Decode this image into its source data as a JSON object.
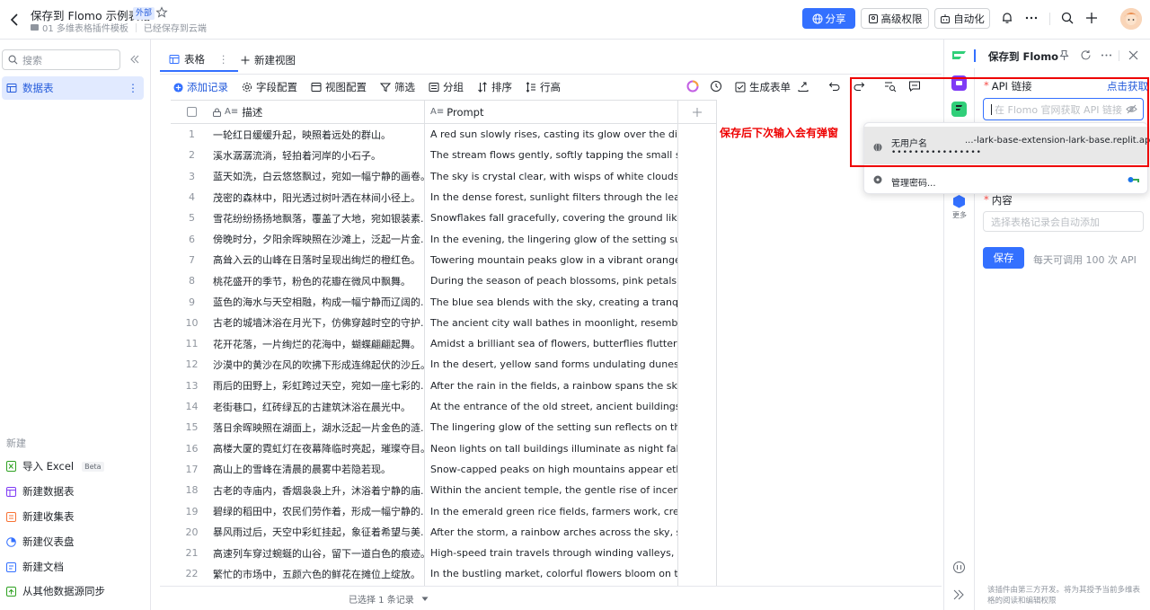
{
  "header": {
    "title": "保存到 Flomo 示例表格",
    "badge": "外部",
    "breadcrumb": "01 多维表格插件模板",
    "save_status": "已经保存到云端",
    "share_label": "分享",
    "permission_label": "高级权限",
    "automation_label": "自动化"
  },
  "sidebar": {
    "search_placeholder": "搜索",
    "active_item": "数据表",
    "new_section_label": "新建",
    "new_items": [
      {
        "label": "导入 Excel",
        "icon": "excel-icon",
        "badge": "Beta"
      },
      {
        "label": "新建数据表",
        "icon": "table-icon"
      },
      {
        "label": "新建收集表",
        "icon": "form-icon"
      },
      {
        "label": "新建仪表盘",
        "icon": "dashboard-icon"
      },
      {
        "label": "新建文档",
        "icon": "doc-icon"
      },
      {
        "label": "从其他数据源同步",
        "icon": "sync-icon"
      }
    ]
  },
  "views": {
    "active_tab": "表格",
    "new_view_label": "新建视图"
  },
  "toolbar": {
    "add_record": "添加记录",
    "field_config": "字段配置",
    "view_config": "视图配置",
    "filter": "筛选",
    "group": "分组",
    "sort": "排序",
    "row_height": "行高",
    "generate_form": "生成表单"
  },
  "table": {
    "columns": [
      "描述",
      "Prompt"
    ],
    "rows": [
      {
        "n": "1",
        "desc": "一轮红日缓缓升起，映照着远处的群山。",
        "prompt": "A red sun slowly rises, casting its glow over the distant ..."
      },
      {
        "n": "2",
        "desc": "溪水潺潺流淌，轻拍着河岸的小石子。",
        "prompt": "The stream flows gently, softly tapping the small stones..."
      },
      {
        "n": "3",
        "desc": "蓝天如洗，白云悠悠飘过，宛如一幅宁静的画卷。",
        "prompt": "The sky is crystal clear, with wisps of white clouds drifti..."
      },
      {
        "n": "4",
        "desc": "茂密的森林中，阳光透过树叶洒在林间小径上。",
        "prompt": "In the dense forest, sunlight filters through the leaves, ..."
      },
      {
        "n": "5",
        "desc": "雪花纷纷扬扬地飘落，覆盖了大地，宛如银装素...",
        "prompt": "Snowflakes fall gracefully, covering the ground like a sil..."
      },
      {
        "n": "6",
        "desc": "傍晚时分，夕阳余晖映照在沙滩上，泛起一片金...",
        "prompt": "In the evening, the lingering glow of the setting sun refl..."
      },
      {
        "n": "7",
        "desc": "高耸入云的山峰在日落时呈现出绚烂的橙红色。",
        "prompt": "Towering mountain peaks glow in a vibrant orange hue ..."
      },
      {
        "n": "8",
        "desc": "桃花盛开的季节，粉色的花瓣在微风中飘舞。",
        "prompt": "During the season of peach blossoms, pink petals danc..."
      },
      {
        "n": "9",
        "desc": "蓝色的海水与天空相融，构成一幅宁静而辽阔的...",
        "prompt": "The blue sea blends with the sky, creating a tranquil an..."
      },
      {
        "n": "10",
        "desc": "古老的城墙沐浴在月光下，仿佛穿越时空的守护...",
        "prompt": "The ancient city wall bathes in moonlight, resembling a ..."
      },
      {
        "n": "11",
        "desc": "花开花落，一片绚烂的花海中，蝴蝶翩翩起舞。",
        "prompt": "Amidst a brilliant sea of flowers, butterflies flutter grace..."
      },
      {
        "n": "12",
        "desc": "沙漠中的黄沙在风的吹拂下形成连绵起伏的沙丘。",
        "prompt": "In the desert, yellow sand forms undulating dunes unde..."
      },
      {
        "n": "13",
        "desc": "雨后的田野上，彩虹跨过天空，宛如一座七彩的...",
        "prompt": "After the rain in the fields, a rainbow spans the sky, res..."
      },
      {
        "n": "14",
        "desc": "老街巷口，红砖绿瓦的古建筑沐浴在晨光中。",
        "prompt": "At the entrance of the old street, ancient buildings with ..."
      },
      {
        "n": "15",
        "desc": "落日余晖映照在湖面上，湖水泛起一片金色的涟...",
        "prompt": "The lingering glow of the setting sun reflects on the lak..."
      },
      {
        "n": "16",
        "desc": "高楼大厦的霓虹灯在夜幕降临时亮起，璀璨夺目。",
        "prompt": "Neon lights on tall buildings illuminate as night falls, da..."
      },
      {
        "n": "17",
        "desc": "高山上的雪峰在清晨的晨雾中若隐若现。",
        "prompt": "Snow-capped peaks on high mountains appear etherea..."
      },
      {
        "n": "18",
        "desc": "古老的寺庙内，香烟袅袅上升，沐浴着宁静的庙...",
        "prompt": "Within the ancient temple, the gentle rise of incense sm..."
      },
      {
        "n": "19",
        "desc": "碧绿的稻田中，农民们劳作着，形成一幅宁静的...",
        "prompt": "In the emerald green rice fields, farmers work, creating ..."
      },
      {
        "n": "20",
        "desc": "暴风雨过后，天空中彩虹挂起，象征着希望与美...",
        "prompt": "After the storm, a rainbow arches across the sky, symb..."
      },
      {
        "n": "21",
        "desc": "高速列车穿过蜿蜒的山谷，留下一道白色的痕迹。",
        "prompt": "High-speed train travels through winding valleys, leavin..."
      },
      {
        "n": "22",
        "desc": "繁忙的市场中，五颜六色的鲜花在摊位上绽放。",
        "prompt": "In the bustling market, colorful flowers bloom on the st..."
      }
    ]
  },
  "status_bar": {
    "selected": "已选择 1 条记录"
  },
  "annotation": {
    "text": "保存后下次输入会有弹窗"
  },
  "panel": {
    "title": "保存到 Flomo",
    "api_label": "API 链接",
    "get_link": "点击获取",
    "api_placeholder": "在 Flomo 官网获取 API 链接",
    "content_label": "内容",
    "content_placeholder": "选择表格记录会自动添加",
    "save_label": "保存",
    "quota_text": "每天可调用 100 次 API",
    "more_label": "更多",
    "disclaimer": "该插件由第三方开发。将为其授予当前多维表格的阅读和编辑权限"
  },
  "autofill": {
    "username": "无用户名",
    "password_mask": "••••••••••••••••",
    "site": "...-lark-base-extension-lark-base.replit.app",
    "manage_label": "管理密码..."
  },
  "colors": {
    "accent": "#3370ff",
    "annotation": "#ee0000",
    "selected_nav_bg": "#e1eaff"
  }
}
